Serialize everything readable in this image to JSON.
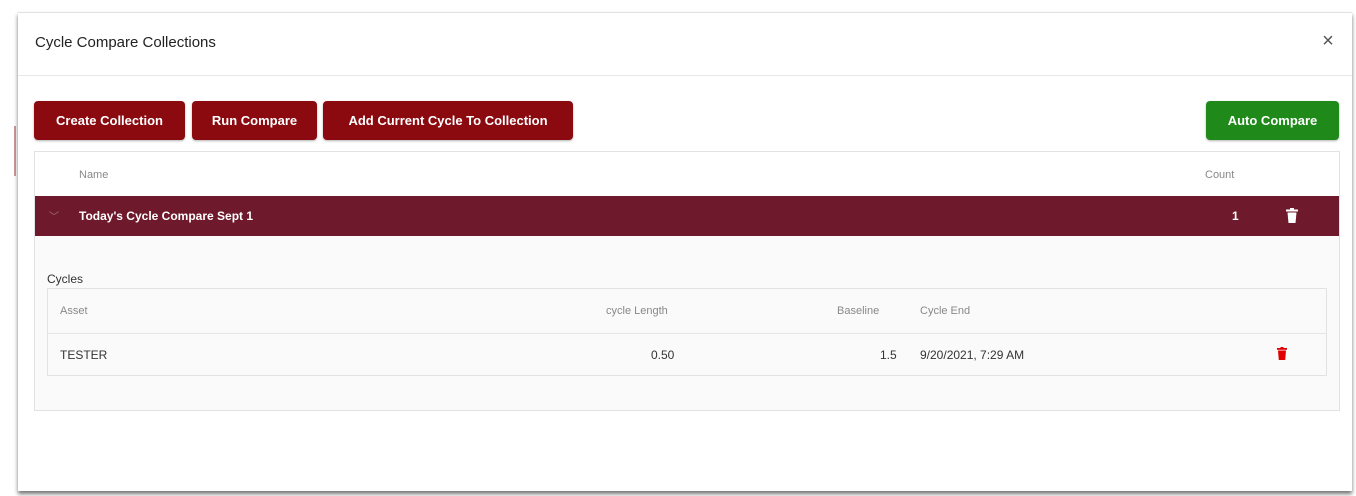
{
  "modal": {
    "title": "Cycle Compare Collections",
    "close_icon": "close-icon"
  },
  "toolbar": {
    "create_collection": "Create Collection",
    "run_compare": "Run Compare",
    "add_current_cycle": "Add Current Cycle To Collection",
    "auto_compare": "Auto Compare"
  },
  "collections_table": {
    "columns": {
      "name": "Name",
      "count": "Count"
    },
    "rows": [
      {
        "name": "Today's Cycle Compare Sept 1",
        "count": "1",
        "delete_icon": "trash-icon"
      }
    ]
  },
  "cycles": {
    "label": "Cycles",
    "columns": {
      "asset": "Asset",
      "cycle_length": "cycle Length",
      "baseline": "Baseline",
      "cycle_end": "Cycle End"
    },
    "rows": [
      {
        "asset": "TESTER",
        "cycle_length": "0.50",
        "baseline": "1.5",
        "cycle_end": "9/20/2021, 7:29 AM",
        "delete_icon": "trash-icon"
      }
    ]
  },
  "colors": {
    "primary_red": "#8a0a10",
    "selected_row": "#6e1a2c",
    "success_green": "#1f8a1a",
    "delete_red": "#e00000"
  }
}
